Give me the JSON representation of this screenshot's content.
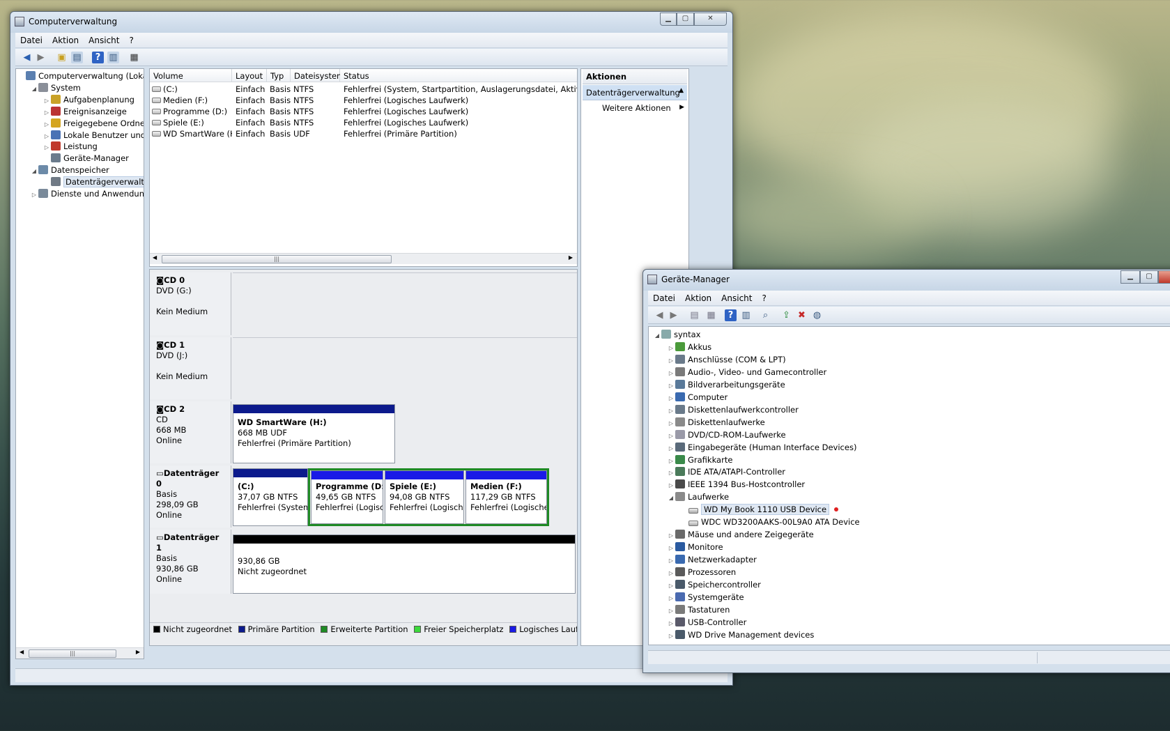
{
  "colors": {
    "unallocated": "#000000",
    "primary": "#0c1a8c",
    "extended": "#1f8a25",
    "free": "#3cd93c",
    "logical": "#1a1ae6"
  },
  "cm": {
    "title": "Computerverwaltung",
    "menu": [
      "Datei",
      "Aktion",
      "Ansicht",
      "?"
    ],
    "tree": [
      {
        "label": "Computerverwaltung (Lokal)",
        "icon": "computer-management-icon",
        "level": 0,
        "exp": ""
      },
      {
        "label": "System",
        "icon": "tools-icon",
        "level": 1,
        "exp": "open"
      },
      {
        "label": "Aufgabenplanung",
        "icon": "clock-icon",
        "level": 2,
        "exp": "closed"
      },
      {
        "label": "Ereignisanzeige",
        "icon": "event-viewer-icon",
        "level": 2,
        "exp": "closed"
      },
      {
        "label": "Freigegebene Ordner",
        "icon": "shared-folder-icon",
        "level": 2,
        "exp": "closed"
      },
      {
        "label": "Lokale Benutzer und Gruppen",
        "icon": "users-icon",
        "level": 2,
        "exp": "closed"
      },
      {
        "label": "Leistung",
        "icon": "performance-icon",
        "level": 2,
        "exp": "closed"
      },
      {
        "label": "Geräte-Manager",
        "icon": "device-manager-icon",
        "level": 2,
        "exp": ""
      },
      {
        "label": "Datenspeicher",
        "icon": "storage-icon",
        "level": 1,
        "exp": "open"
      },
      {
        "label": "Datenträgerverwaltung",
        "icon": "disk-management-icon",
        "level": 2,
        "exp": "",
        "selected": true
      },
      {
        "label": "Dienste und Anwendungen",
        "icon": "services-icon",
        "level": 1,
        "exp": "closed"
      }
    ],
    "columns": [
      "Volume",
      "Layout",
      "Typ",
      "Dateisystem",
      "Status"
    ],
    "volumes": [
      {
        "volume": "(C:)",
        "layout": "Einfach",
        "typ": "Basis",
        "fs": "NTFS",
        "status": "Fehlerfrei (System, Startpartition, Auslagerungsdatei, Aktiv, Absturzabbild, Primäre Partition)"
      },
      {
        "volume": "Medien (F:)",
        "layout": "Einfach",
        "typ": "Basis",
        "fs": "NTFS",
        "status": "Fehlerfrei (Logisches Laufwerk)"
      },
      {
        "volume": "Programme (D:)",
        "layout": "Einfach",
        "typ": "Basis",
        "fs": "NTFS",
        "status": "Fehlerfrei (Logisches Laufwerk)"
      },
      {
        "volume": "Spiele (E:)",
        "layout": "Einfach",
        "typ": "Basis",
        "fs": "NTFS",
        "status": "Fehlerfrei (Logisches Laufwerk)"
      },
      {
        "volume": "WD SmartWare (H:)",
        "layout": "Einfach",
        "typ": "Basis",
        "fs": "UDF",
        "status": "Fehlerfrei (Primäre Partition)"
      }
    ],
    "disks": [
      {
        "name": "CD 0",
        "l1": "DVD (G:)",
        "l2": "",
        "l3": "Kein Medium"
      },
      {
        "name": "CD 1",
        "l1": "DVD (J:)",
        "l2": "",
        "l3": "Kein Medium"
      },
      {
        "name": "CD 2",
        "l1": "CD",
        "l2": "668 MB",
        "l3": "Online"
      },
      {
        "name": "Datenträger 0",
        "l1": "Basis",
        "l2": "298,09 GB",
        "l3": "Online"
      },
      {
        "name": "Datenträger 1",
        "l1": "Basis",
        "l2": "930,86 GB",
        "l3": "Online"
      }
    ],
    "partitions": {
      "h": {
        "name": "WD SmartWare  (H:)",
        "size": "668 MB UDF",
        "status": "Fehlerfrei (Primäre Partition)"
      },
      "c": {
        "name": "(C:)",
        "size": "37,07 GB NTFS",
        "status": "Fehlerfrei (System,"
      },
      "d": {
        "name": "Programme  (D:)",
        "size": "49,65 GB NTFS",
        "status": "Fehlerfrei (Logisch"
      },
      "e": {
        "name": "Spiele  (E:)",
        "size": "94,08 GB NTFS",
        "status": "Fehlerfrei (Logisches"
      },
      "f": {
        "name": "Medien  (F:)",
        "size": "117,29 GB NTFS",
        "status": "Fehlerfrei (Logisches"
      },
      "u": {
        "name": "",
        "size": "930,86 GB",
        "status": "Nicht zugeordnet"
      }
    },
    "legend": [
      "Nicht zugeordnet",
      "Primäre Partition",
      "Erweiterte Partition",
      "Freier Speicherplatz",
      "Logisches Laufwerk"
    ],
    "actions": {
      "header": "Aktionen",
      "section": "Datenträgerverwaltung",
      "more": "Weitere Aktionen"
    }
  },
  "dm": {
    "title": "Geräte-Manager",
    "menu": [
      "Datei",
      "Aktion",
      "Ansicht",
      "?"
    ],
    "root": "syntax",
    "categories": [
      {
        "label": "Akkus",
        "icon": "battery-icon"
      },
      {
        "label": "Anschlüsse (COM & LPT)",
        "icon": "port-icon"
      },
      {
        "label": "Audio-, Video- und Gamecontroller",
        "icon": "speaker-icon"
      },
      {
        "label": "Bildverarbeitungsgeräte",
        "icon": "scanner-icon"
      },
      {
        "label": "Computer",
        "icon": "computer-icon"
      },
      {
        "label": "Diskettenlaufwerkcontroller",
        "icon": "floppy-controller-icon"
      },
      {
        "label": "Diskettenlaufwerke",
        "icon": "floppy-icon"
      },
      {
        "label": "DVD/CD-ROM-Laufwerke",
        "icon": "dvd-icon"
      },
      {
        "label": "Eingabegeräte (Human Interface Devices)",
        "icon": "hid-icon"
      },
      {
        "label": "Grafikkarte",
        "icon": "display-adapter-icon"
      },
      {
        "label": "IDE ATA/ATAPI-Controller",
        "icon": "ide-icon"
      },
      {
        "label": "IEEE 1394 Bus-Hostcontroller",
        "icon": "firewire-icon"
      },
      {
        "label": "Laufwerke",
        "icon": "drive-icon",
        "open": true,
        "children": [
          "WD My Book 1110 USB Device",
          "WDC WD3200AAKS-00L9A0 ATA Device"
        ]
      },
      {
        "label": "Mäuse und andere Zeigegeräte",
        "icon": "mouse-icon"
      },
      {
        "label": "Monitore",
        "icon": "monitor-icon"
      },
      {
        "label": "Netzwerkadapter",
        "icon": "network-icon"
      },
      {
        "label": "Prozessoren",
        "icon": "cpu-icon"
      },
      {
        "label": "Speichercontroller",
        "icon": "storage-controller-icon"
      },
      {
        "label": "Systemgeräte",
        "icon": "system-device-icon"
      },
      {
        "label": "Tastaturen",
        "icon": "keyboard-icon"
      },
      {
        "label": "USB-Controller",
        "icon": "usb-icon"
      },
      {
        "label": "WD Drive Management devices",
        "icon": "wd-icon"
      }
    ]
  }
}
